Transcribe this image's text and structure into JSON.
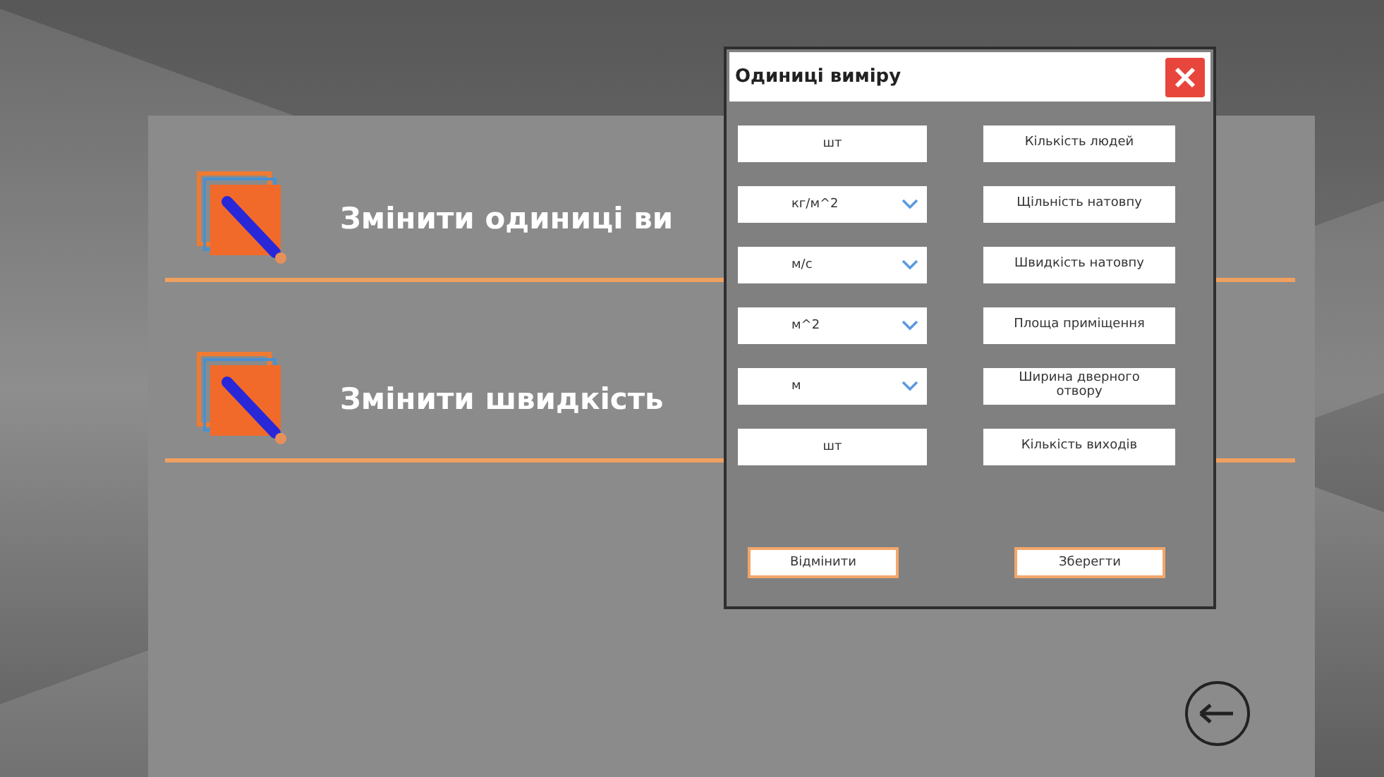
{
  "menu": [
    {
      "label": "Змінити одиниці ви"
    },
    {
      "label": "Змінити швидкість"
    }
  ],
  "dialog": {
    "title": "Одиниці виміру",
    "fields": [
      {
        "kind": "text",
        "value": "шт",
        "label": "Кількість людей"
      },
      {
        "kind": "select",
        "value": "кг/м^2",
        "label": "Щільність натовпу"
      },
      {
        "kind": "select",
        "value": "м/с",
        "label": "Швидкість натовпу"
      },
      {
        "kind": "select",
        "value": "м^2",
        "label": "Площа приміщення"
      },
      {
        "kind": "select",
        "value": "м",
        "label": "Ширина дверного отвору"
      },
      {
        "kind": "text",
        "value": "шт",
        "label": "Кількість виходів"
      }
    ],
    "buttons": [
      "Відмінити",
      "Зберегти"
    ]
  }
}
